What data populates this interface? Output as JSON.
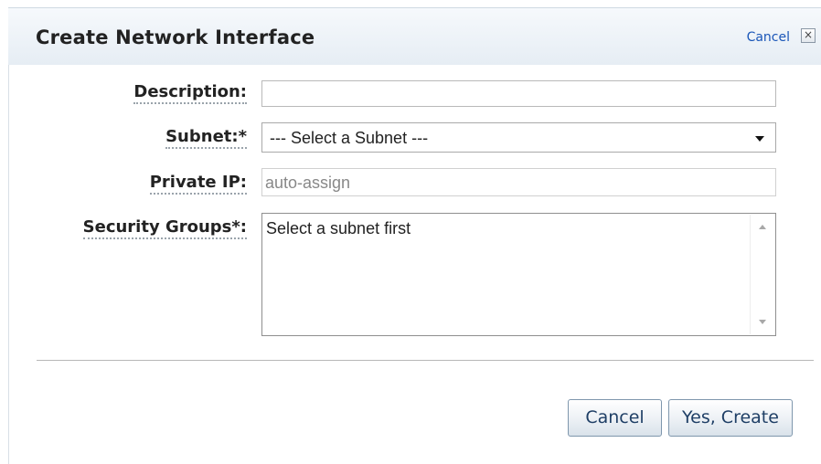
{
  "dialog": {
    "title": "Create Network Interface",
    "close_label": "Cancel",
    "close_icon": "close-x-icon"
  },
  "form": {
    "description": {
      "label": "Description:",
      "value": ""
    },
    "subnet": {
      "label": "Subnet:*",
      "selected": "--- Select a Subnet ---"
    },
    "private_ip": {
      "label": "Private IP:",
      "value": "auto-assign"
    },
    "security_groups": {
      "label": "Security Groups*:",
      "message": "Select a subnet first"
    }
  },
  "buttons": {
    "cancel": "Cancel",
    "create": "Yes, Create"
  }
}
